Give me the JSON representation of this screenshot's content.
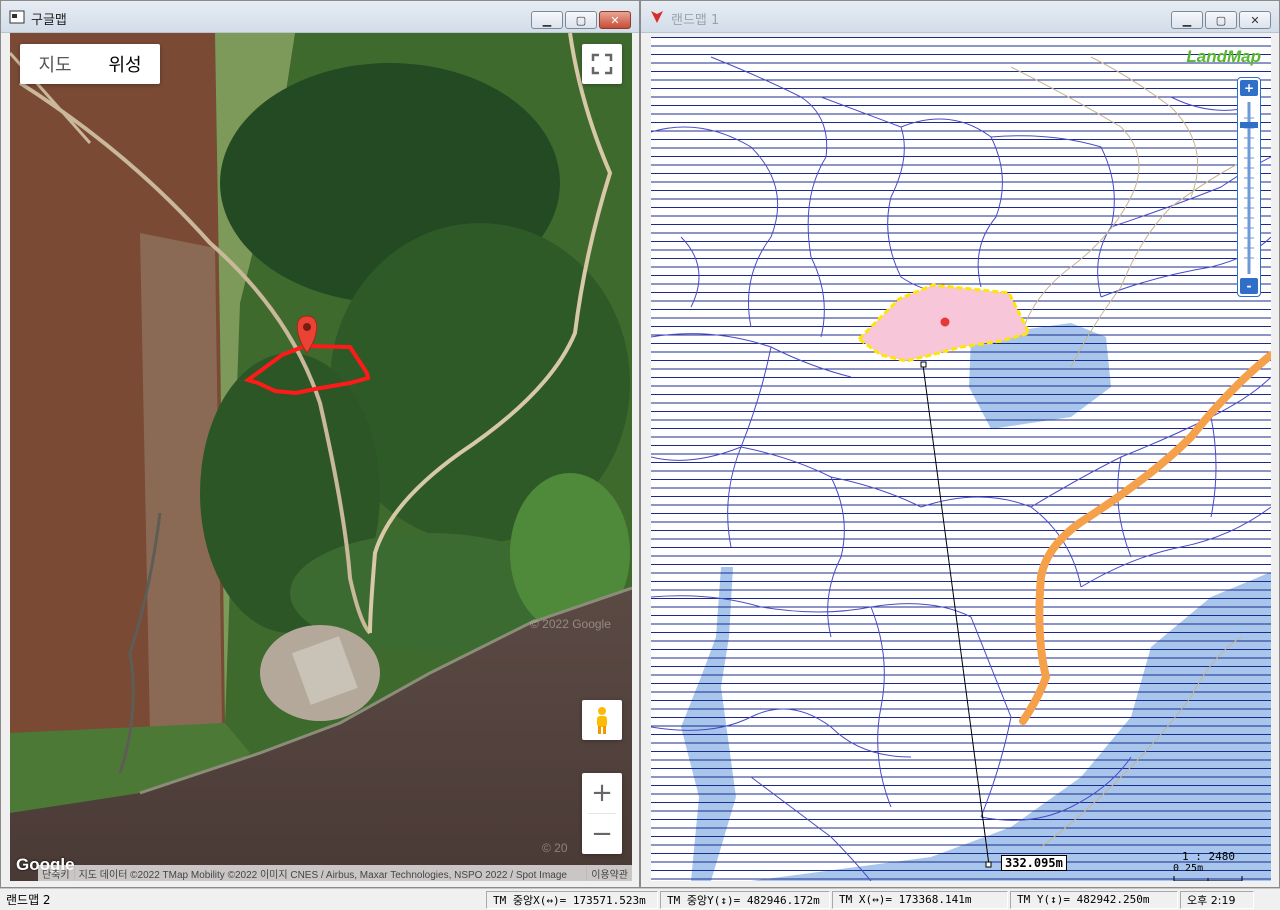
{
  "left_window": {
    "title": "구글맵",
    "map_type": {
      "map_label": "지도",
      "satellite_label": "위성"
    },
    "google_logo": "Google",
    "attribution": {
      "shortcut": "단축키",
      "map_data": "지도 데이터 ©2022 TMap Mobility ©2022 이미지 CNES / Airbus, Maxar Technologies, NSPO 2022 / Spot Image",
      "terms": "이용약관"
    },
    "watermark": "© 2022 Google",
    "watermark_partial": "© 20"
  },
  "right_window": {
    "title": "랜드맵 1",
    "logo": "LandMap",
    "zoom_in": "+",
    "zoom_out": "-",
    "scale_ratio": "1 : 2480",
    "scale_bar": "0   25m",
    "distance_label": "332.095m"
  },
  "statusbar": {
    "main": "랜드맵 2",
    "tm_center_x": "TM 중앙X(↔)= 173571.523m",
    "tm_center_y": "TM 중앙Y(↕)= 482946.172m",
    "tm_x": "TM X(↔)= 173368.141m",
    "tm_y": "TM Y(↕)= 482942.250m",
    "clock": "오후 2:19"
  },
  "colors": {
    "parcel_fill": "#f7c6d8",
    "parcel_outline": "#ffe600",
    "water": "#a8c6ec",
    "road": "#f5a04b",
    "marker_red": "#e53935"
  }
}
